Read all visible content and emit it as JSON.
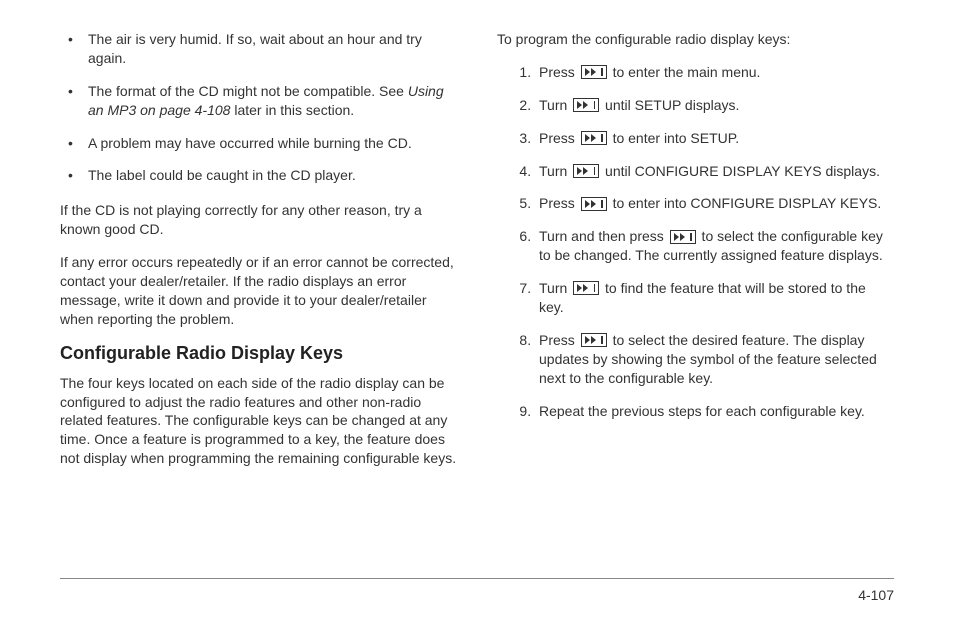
{
  "left": {
    "bullets": [
      "The air is very humid. If so, wait about an hour and try again.",
      "The format of the CD might not be compatible. See ",
      "A problem may have occurred while burning the CD.",
      "The label could be caught in the CD player."
    ],
    "mp3_ref_italic": "Using an MP3 on page 4-108",
    "mp3_ref_tail": " later in this section.",
    "p1": "If the CD is not playing correctly for any other reason, try a known good CD.",
    "p2": "If any error occurs repeatedly or if an error cannot be corrected, contact your dealer/retailer. If the radio displays an error message, write it down and provide it to your dealer/retailer when reporting the problem.",
    "heading": "Configurable Radio Display Keys",
    "p3": "The four keys located on each side of the radio display can be configured to adjust the radio features and other non-radio related features. The configurable keys can be changed at any time. Once a feature is programmed to a key, the feature does not display when programming the remaining configurable keys."
  },
  "right": {
    "intro": "To program the configurable radio display keys:",
    "steps": {
      "s1a": "Press ",
      "s1b": " to enter the main menu.",
      "s2a": "Turn ",
      "s2b": " until SETUP displays.",
      "s3a": "Press ",
      "s3b": " to enter into SETUP.",
      "s4a": "Turn ",
      "s4b": " until CONFIGURE DISPLAY KEYS displays.",
      "s5a": "Press ",
      "s5b": " to enter into CONFIGURE DISPLAY KEYS.",
      "s6a": "Turn and then press ",
      "s6b": " to select the configurable key to be changed. The currently assigned feature displays.",
      "s7a": "Turn ",
      "s7b": " to find the feature that will be stored to the key.",
      "s8a": "Press ",
      "s8b": " to select the desired feature. The display updates by showing the symbol of the feature selected next to the configurable key.",
      "s9": "Repeat the previous steps for each configurable key."
    }
  },
  "page_number": "4-107"
}
